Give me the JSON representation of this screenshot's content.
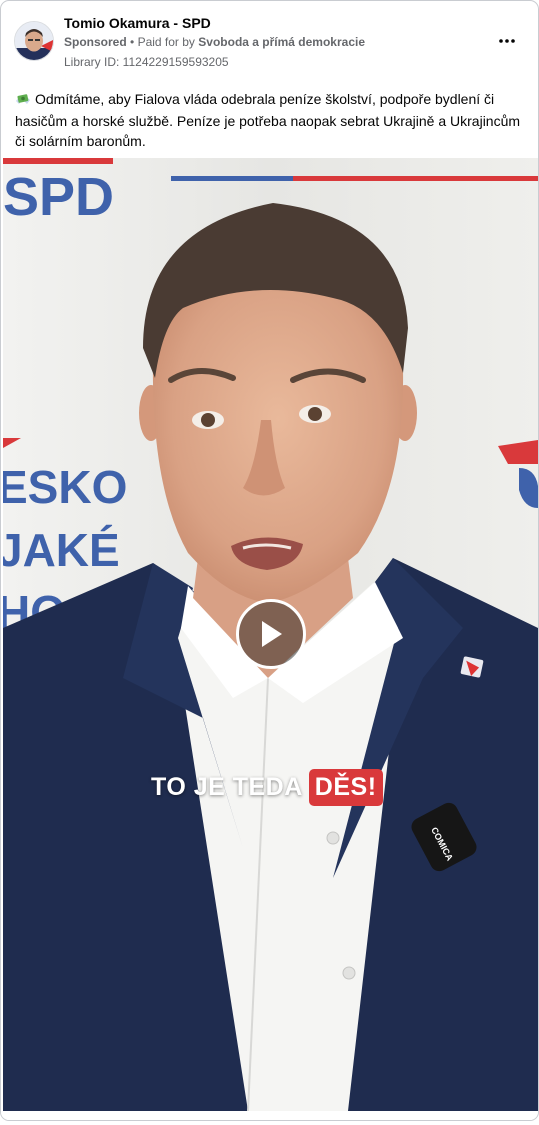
{
  "post": {
    "page_name": "Tomio Okamura - SPD",
    "sponsored_label": "Sponsored",
    "separator": "•",
    "paid_for_prefix": "Paid for by",
    "payer": "Svoboda a přímá demokracie",
    "library_id": "Library ID: 1124229159593205",
    "body_text": "Odmítáme, aby Fialova vláda odebrala peníze školství, podpoře bydlení či hasičům a horské službě. Peníze je potřeba naopak sebrat Ukrajině a Ukrajincům či solárním baronům."
  },
  "media": {
    "background_lettering": [
      "SPD",
      "ESKO",
      "JAKÉ",
      "HO"
    ],
    "mic_label": "COMICA",
    "caption_prefix": "TO JE TEDA",
    "caption_highlight": "DĚS!"
  },
  "icons": {
    "more": "more-horizontal-icon",
    "play": "play-icon",
    "emoji": "money-with-wings-icon"
  },
  "colors": {
    "accent_red": "#d9393b",
    "spd_blue": "#2c4e9a",
    "suit_navy": "#1e2b4e"
  }
}
